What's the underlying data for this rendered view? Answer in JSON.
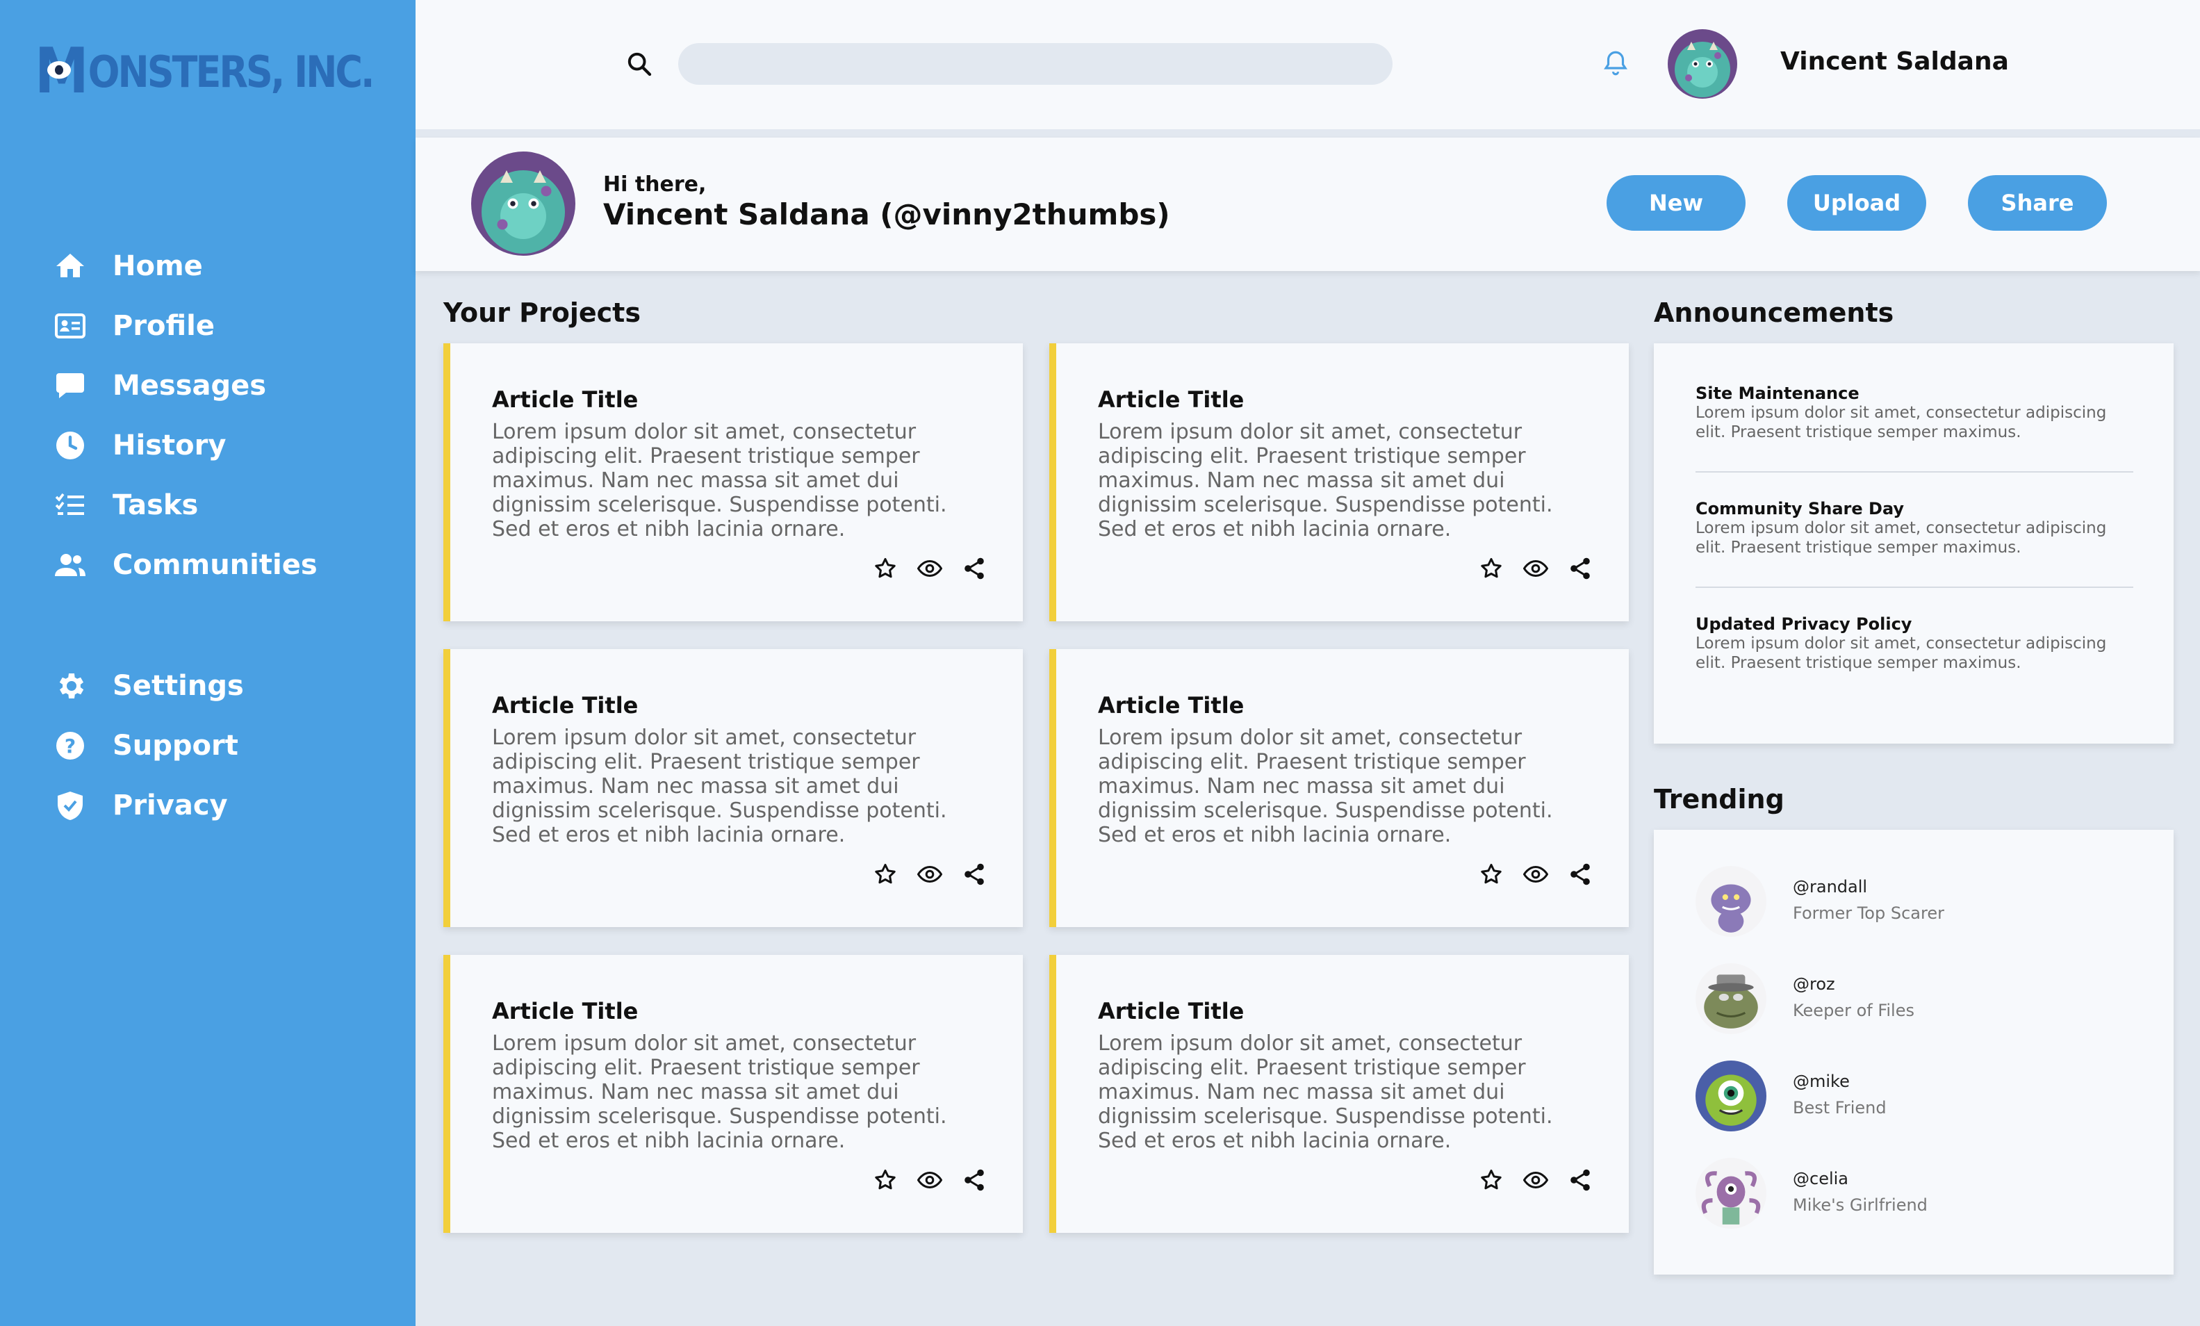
{
  "brand": {
    "logo_m": "M",
    "logo_text": "ONSTERS, INC."
  },
  "sidebar": {
    "items": [
      {
        "label": "Home",
        "icon": "home-icon"
      },
      {
        "label": "Profile",
        "icon": "id-card-icon"
      },
      {
        "label": "Messages",
        "icon": "chat-bubble-icon"
      },
      {
        "label": "History",
        "icon": "clock-icon"
      },
      {
        "label": "Tasks",
        "icon": "checklist-icon"
      },
      {
        "label": "Communities",
        "icon": "users-icon"
      }
    ],
    "secondary": [
      {
        "label": "Settings",
        "icon": "gear-icon"
      },
      {
        "label": "Support",
        "icon": "help-circle-icon"
      },
      {
        "label": "Privacy",
        "icon": "shield-icon"
      }
    ]
  },
  "topbar": {
    "search_placeholder": "",
    "username": "Vincent Saldana"
  },
  "greeting": {
    "small": "Hi there,",
    "big": "Vincent Saldana (@vinny2thumbs)",
    "buttons": {
      "new": "New",
      "upload": "Upload",
      "share": "Share"
    }
  },
  "projects": {
    "title": "Your Projects",
    "cards": [
      {
        "title": "Article Title",
        "body": "Lorem ipsum dolor sit amet, consectetur adipiscing elit. Praesent tristique semper maximus. Nam nec massa sit amet dui dignissim scelerisque. Suspendisse potenti. Sed et eros et nibh lacinia ornare."
      },
      {
        "title": "Article Title",
        "body": "Lorem ipsum dolor sit amet, consectetur adipiscing elit. Praesent tristique semper maximus. Nam nec massa sit amet dui dignissim scelerisque. Suspendisse potenti. Sed et eros et nibh lacinia ornare."
      },
      {
        "title": "Article Title",
        "body": "Lorem ipsum dolor sit amet, consectetur adipiscing elit. Praesent tristique semper maximus. Nam nec massa sit amet dui dignissim scelerisque. Suspendisse potenti. Sed et eros et nibh lacinia ornare."
      },
      {
        "title": "Article Title",
        "body": "Lorem ipsum dolor sit amet, consectetur adipiscing elit. Praesent tristique semper maximus. Nam nec massa sit amet dui dignissim scelerisque. Suspendisse potenti. Sed et eros et nibh lacinia ornare."
      },
      {
        "title": "Article Title",
        "body": "Lorem ipsum dolor sit amet, consectetur adipiscing elit. Praesent tristique semper maximus. Nam nec massa sit amet dui dignissim scelerisque. Suspendisse potenti. Sed et eros et nibh lacinia ornare."
      },
      {
        "title": "Article Title",
        "body": "Lorem ipsum dolor sit amet, consectetur adipiscing elit. Praesent tristique semper maximus. Nam nec massa sit amet dui dignissim scelerisque. Suspendisse potenti. Sed et eros et nibh lacinia ornare."
      }
    ]
  },
  "announcements": {
    "title": "Announcements",
    "items": [
      {
        "title": "Site Maintenance",
        "body": "Lorem ipsum dolor sit amet, consectetur adipiscing elit. Praesent tristique semper maximus."
      },
      {
        "title": "Community Share Day",
        "body": "Lorem ipsum dolor sit amet, consectetur adipiscing elit. Praesent tristique semper maximus."
      },
      {
        "title": "Updated Privacy Policy",
        "body": "Lorem ipsum dolor sit amet, consectetur adipiscing elit. Praesent tristique semper maximus."
      }
    ]
  },
  "trending": {
    "title": "Trending",
    "items": [
      {
        "handle": "@randall",
        "subtitle": "Former Top Scarer",
        "avatar_color": "#8b7ab8"
      },
      {
        "handle": "@roz",
        "subtitle": "Keeper of Files",
        "avatar_color": "#7d8a5a"
      },
      {
        "handle": "@mike",
        "subtitle": "Best Friend",
        "avatar_color": "#8fc03c"
      },
      {
        "handle": "@celia",
        "subtitle": "Mike's Girlfriend",
        "avatar_color": "#9b6fa8"
      }
    ]
  },
  "colors": {
    "sidebar": "#4aa0e3",
    "accent": "#4aa0e3",
    "card_border": "#f2cf3b",
    "background": "#e2e8f0"
  }
}
